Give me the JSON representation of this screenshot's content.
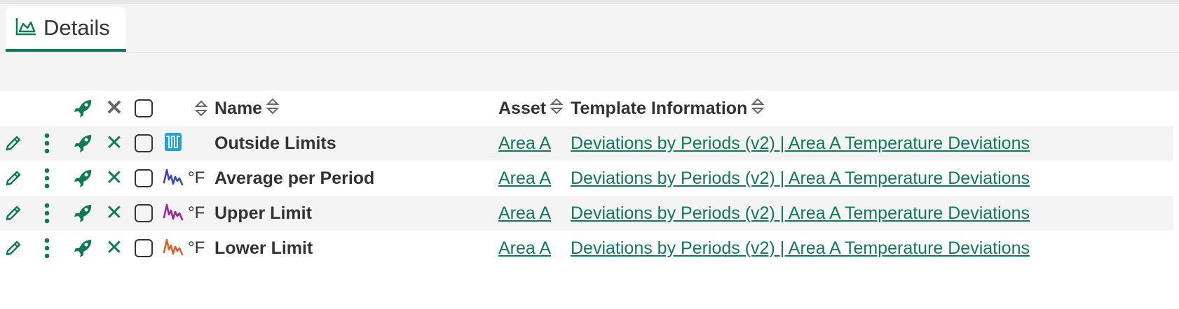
{
  "tab": {
    "label": "Details",
    "icon": "area-chart-icon"
  },
  "colors": {
    "accent": "#0f7a5a",
    "text": "#333333",
    "row_alt": "#f4f4f4"
  },
  "columns": {
    "name": "Name",
    "asset": "Asset",
    "template": "Template Information"
  },
  "rows": [
    {
      "name": "Outside Limits",
      "unit": "",
      "swatch": "condition-swatch",
      "swatch_color": "#1fa2d8",
      "asset": "Area A",
      "template": "Deviations by Periods (v2) | Area A Temperature Deviations"
    },
    {
      "name": "Average per Period",
      "unit": "°F",
      "swatch": "signal-swatch",
      "swatch_color": "#3a49b5",
      "asset": "Area A",
      "template": "Deviations by Periods (v2) | Area A Temperature Deviations"
    },
    {
      "name": "Upper Limit",
      "unit": "°F",
      "swatch": "signal-swatch",
      "swatch_color": "#9a2a8f",
      "asset": "Area A",
      "template": "Deviations by Periods (v2) | Area A Temperature Deviations"
    },
    {
      "name": "Lower Limit",
      "unit": "°F",
      "swatch": "signal-swatch",
      "swatch_color": "#d9632a",
      "asset": "Area A",
      "template": "Deviations by Periods (v2) | Area A Temperature Deviations"
    }
  ]
}
